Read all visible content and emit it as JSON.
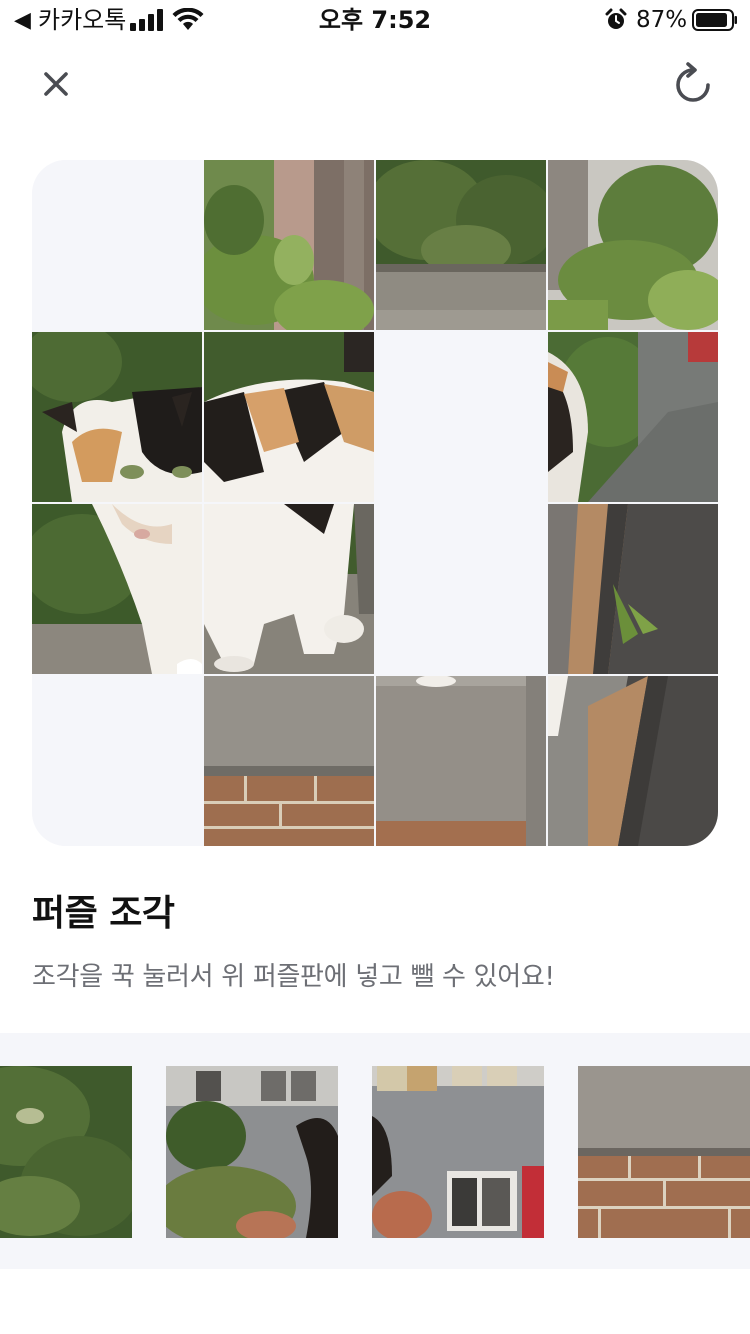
{
  "status_bar": {
    "back_app": "카카오톡",
    "time": "오후 7:52",
    "battery": "87%",
    "icons": [
      "back-arrow-icon",
      "signal-icon",
      "wifi-icon",
      "alarm-icon",
      "battery-icon"
    ]
  },
  "toolbar": {
    "close_icon": "close-icon",
    "refresh_icon": "refresh-icon"
  },
  "board": {
    "rows": 4,
    "cols": 4,
    "empty_cells": [
      0,
      6,
      10,
      12
    ]
  },
  "pieces_section": {
    "title": "퍼즐 조각",
    "description": "조각을 꾹 눌러서 위 퍼즐판에 넣고 뺄 수 있어요!"
  },
  "tray": {
    "piece_count": 4
  },
  "colors": {
    "accent_bg": "#f5f6fa",
    "text_primary": "#111111",
    "text_secondary": "#6d6f75"
  }
}
